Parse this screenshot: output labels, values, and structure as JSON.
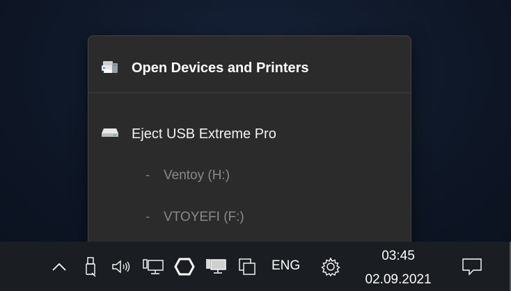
{
  "menu": {
    "open_devices_label": "Open Devices and Printers",
    "open_devices_icon": "devices-printers-icon",
    "eject_label": "Eject USB Extreme Pro",
    "eject_icon": "usb-drive-icon",
    "sub_items": [
      {
        "dash": "-",
        "label": "Ventoy (H:)"
      },
      {
        "dash": "-",
        "label": "VTOYEFI (F:)"
      }
    ]
  },
  "taskbar": {
    "icons": [
      "chevron-up-icon",
      "usb-eject-icon",
      "volume-icon",
      "network-icon",
      "hexagon-icon",
      "display-icon",
      "window-copy-icon",
      "gear-icon",
      "notification-icon"
    ],
    "language": "ENG",
    "time": "03:45",
    "date": "02.09.2021"
  },
  "colors": {
    "menu_bg": "#2b2b2b",
    "taskbar_bg": "#1a1d22",
    "text_primary": "#ffffff",
    "text_disabled": "#8a8a8a"
  }
}
